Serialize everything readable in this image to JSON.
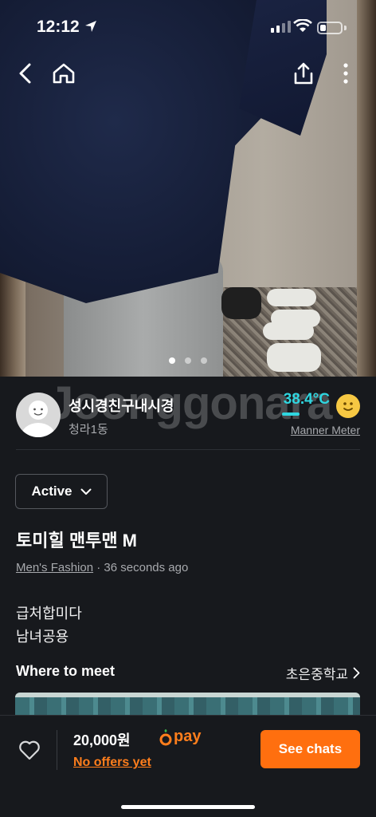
{
  "status_bar": {
    "time": "12:12"
  },
  "photo": {
    "page_count": 3,
    "current_page": 1
  },
  "seller": {
    "name": "성시경친구내시경",
    "area": "청라1동",
    "watermark": "Joonggonara",
    "temperature": "38.4°C",
    "manner_label": "Manner Meter"
  },
  "listing": {
    "status": "Active",
    "title": "토미힐 맨투맨 M",
    "category": "Men's Fashion",
    "time_ago": " · 36 seconds ago",
    "description_line1": "급처합미다",
    "description_line2": "남녀공용",
    "where_label": "Where to meet",
    "place": "초은중학교"
  },
  "bottom_bar": {
    "price": "20,000원",
    "pay_label": "pay",
    "offers": "No offers yet",
    "chat_button": "See chats"
  },
  "colors": {
    "accent": "#ff6f0f",
    "temperature": "#2fd6e0",
    "background": "#17191d"
  }
}
